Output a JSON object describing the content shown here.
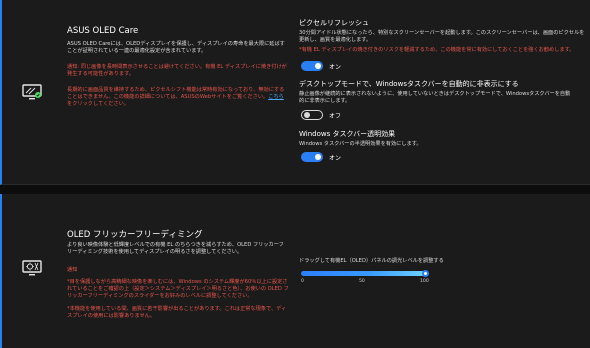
{
  "oled_care": {
    "title": "ASUS OLED Care",
    "desc": "ASUS OLED Careには、OLEDディスプレイを保護し、ディスプレイの寿命を最大限に延ばすことが証明されている一連の最適化設定が含まれています。",
    "warn": "通知: 同じ画像を長時間表示させることは避けてください。有機 EL ディスプレイに焼き付けが発生する可能性があります。",
    "warn2_prefix": "長期的に画面品質を維持するため、ピクセルシフト機能は常時有効になっており、無効にすることはできません。この機能の詳細については、ASUSのWebサイトをご覧ください。",
    "link_text": "こちら",
    "link_suffix": "をクリックしてください。"
  },
  "pixel_refresh": {
    "title": "ピクセルリフレッシュ",
    "desc1": "30分間アイドル状態になったら、特別なスクリーンセーバーを起動します。このスクリーンセーバーは、画面のピクセルを",
    "desc2": "更新し、画質を最適化します。",
    "warn": "*有機 EL ディスプレイの焼き付きのリスクを軽減するため、この機能を常に有効にしておくことを強くお勧めします。",
    "toggle_label": "オン"
  },
  "taskbar_hide": {
    "title": "デスクトップモードで、Windowsタスクバーを自動的に非表示にする",
    "desc1": "静止画像が継続的に表示されないように、使用していないときはデスクトップモードで、Windowsタスクバーを自動",
    "desc2": "的に非表示にします。",
    "toggle_label": "オフ"
  },
  "taskbar_transparency": {
    "title": "Windows タスクバー透明効果",
    "desc": "Windows タスクバーの半透明効果を有効にします。",
    "toggle_label": "オン"
  },
  "flicker_free": {
    "title": "OLED フリッカーフリーディミング",
    "desc": "より良い映像体験と低輝度レベルでの有機 EL のちらつきを減らすため、OLED フリッカーフリーディミング技術を使用してディスプレイの明るさを調整してください。",
    "notice_label": "通知",
    "warn1": "*目を保護しながら高精細な映像を楽しむには、Windows のシステム輝度が60％以上に設定されていることをご確認の上（設定＞システム＞ディスプレイ＞明るさと色）、お使いの OLED フリッカーフリーディミングのスライダーをお好みのレベルに調整してください。",
    "warn2": "*本機能を使用している間、画質に若干影響が出ることがあります。これは正常な現象で、ディスプレイの使用には影響ありません。",
    "slider_label": "ドラッグして有機EL（OLED）パネルの調光レベルを調整する",
    "slider_value": 100,
    "ticks": [
      "0",
      "50",
      "100"
    ]
  },
  "colors": {
    "accent": "#2b7ff5",
    "warning": "#e8554b",
    "panel_bg": "#1b1b1b",
    "page_bg": "#0d0d0d"
  },
  "icons": [
    "monitor-sparkle-icon",
    "monitor-dim-icon"
  ]
}
